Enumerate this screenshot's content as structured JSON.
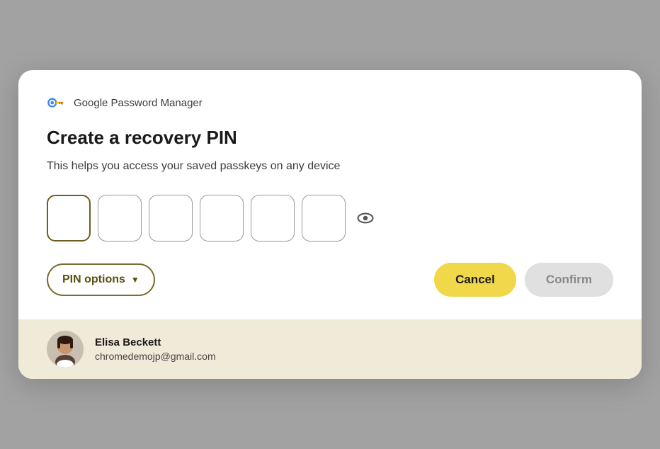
{
  "header": {
    "app_name": "Google Password Manager"
  },
  "dialog": {
    "title": "Create a recovery PIN",
    "subtitle": "This helps you access your saved passkeys on any device",
    "pin_boxes": [
      "",
      "",
      "",
      "",
      "",
      ""
    ],
    "buttons": {
      "pin_options": "PIN options",
      "cancel": "Cancel",
      "confirm": "Confirm"
    }
  },
  "account": {
    "name": "Elisa Beckett",
    "email": "chromedemojp@gmail.com"
  }
}
